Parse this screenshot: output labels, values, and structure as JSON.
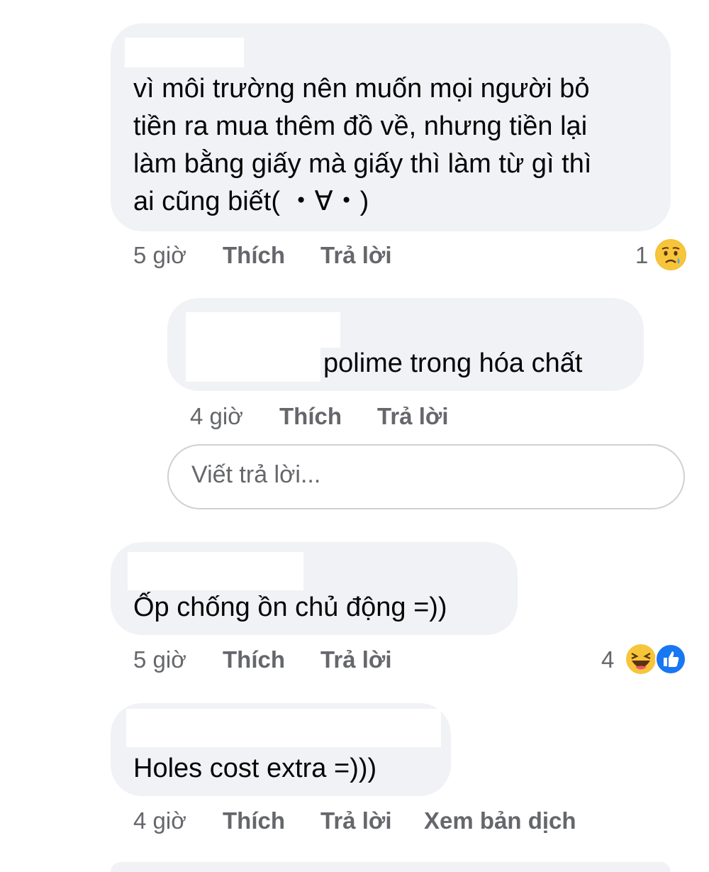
{
  "comments": [
    {
      "text_lines": [
        "vì môi trường nên muốn mọi người bỏ",
        "tiền ra mua thêm đồ về, nhưng tiền lại",
        "làm bằng giấy mà giấy thì làm từ gì thì",
        "ai cũng biết( ・∀・)"
      ],
      "time": "5 giờ",
      "like_label": "Thích",
      "reply_label": "Trả lời",
      "reaction_count": "1",
      "reaction_icons": [
        "sad-face-icon"
      ]
    },
    {
      "text": "polime trong hóa chất",
      "time": "4 giờ",
      "like_label": "Thích",
      "reply_label": "Trả lời"
    },
    {
      "text": "Ốp chống ồn chủ động =))",
      "time": "5 giờ",
      "like_label": "Thích",
      "reply_label": "Trả lời",
      "reaction_count": "4",
      "reaction_icons": [
        "laughing-face-icon",
        "thumbs-up-icon"
      ]
    },
    {
      "text": "Holes cost extra =)))",
      "time": "4 giờ",
      "like_label": "Thích",
      "reply_label": "Trả lời",
      "translate_label": "Xem bản dịch"
    }
  ],
  "reply_box": {
    "placeholder": "Viết trả lời..."
  },
  "colors": {
    "bubble": "#f0f2f5",
    "meta_text": "#65676b",
    "like_blue": "#1877f2",
    "haha_yellow": "#f7b928"
  }
}
